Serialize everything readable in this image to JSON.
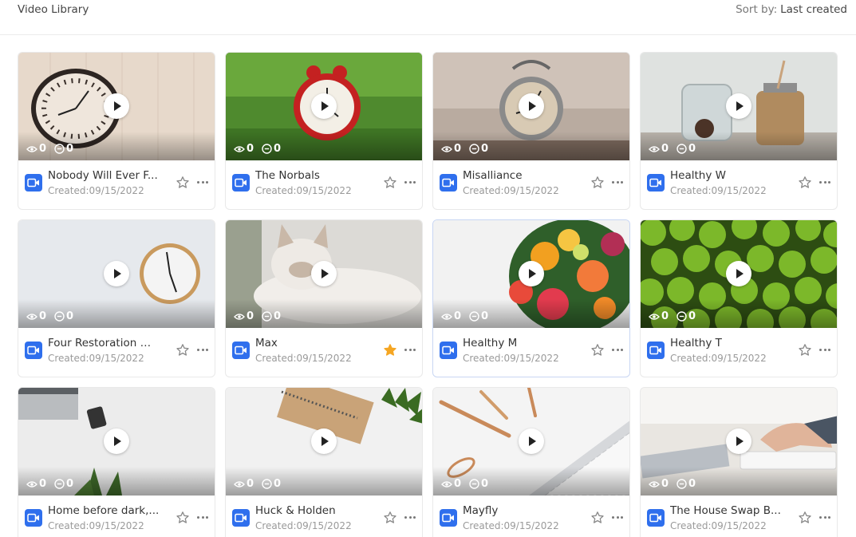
{
  "header": {
    "title": "Video Library",
    "sort_label": "Sort by:",
    "sort_value": "Last created"
  },
  "icons": {
    "views": "eye-icon",
    "comments": "minus-circle-icon",
    "video": "video-camera-icon",
    "favorite": "star-icon",
    "more": "more-horizontal-icon",
    "play": "play-icon"
  },
  "colors": {
    "accent": "#2f6fed",
    "star_active": "#f5a623",
    "star_inactive": "#8a8a8a"
  },
  "videos": [
    {
      "name": "Nobody Will Ever F...",
      "created": "Created:09/15/2022",
      "views": "0",
      "comments": "0",
      "favorite": false,
      "thumbnail": "wall-clock-on-wood"
    },
    {
      "name": "The Norbals",
      "created": "Created:09/15/2022",
      "views": "0",
      "comments": "0",
      "favorite": false,
      "thumbnail": "red-alarm-clock-grass"
    },
    {
      "name": "Misalliance",
      "created": "Created:09/15/2022",
      "views": "0",
      "comments": "0",
      "favorite": false,
      "thumbnail": "silver-alarm-clock"
    },
    {
      "name": "Healthy W",
      "created": "Created:09/15/2022",
      "views": "0",
      "comments": "0",
      "favorite": false,
      "thumbnail": "glass-jars"
    },
    {
      "name": "Four Restoration M...",
      "created": "Created:09/15/2022",
      "views": "0",
      "comments": "0",
      "favorite": false,
      "thumbnail": "wall-clock-white"
    },
    {
      "name": "Max",
      "created": "Created:09/15/2022",
      "views": "0",
      "comments": "0",
      "favorite": true,
      "thumbnail": "white-cat"
    },
    {
      "name": "Healthy M",
      "created": "Created:09/15/2022",
      "views": "0",
      "comments": "0",
      "favorite": false,
      "thumbnail": "fruit-platter"
    },
    {
      "name": "Healthy T",
      "created": "Created:09/15/2022",
      "views": "0",
      "comments": "0",
      "favorite": false,
      "thumbnail": "green-apples"
    },
    {
      "name": "Home before dark,...",
      "created": "Created:09/15/2022",
      "views": "0",
      "comments": "0",
      "favorite": false,
      "thumbnail": "desk-laptop-phone"
    },
    {
      "name": "Huck & Holden",
      "created": "Created:09/15/2022",
      "views": "0",
      "comments": "0",
      "favorite": false,
      "thumbnail": "notebook-plant"
    },
    {
      "name": "Mayfly",
      "created": "Created:09/15/2022",
      "views": "0",
      "comments": "0",
      "favorite": false,
      "thumbnail": "keyboard-pens"
    },
    {
      "name": "The House Swap B...",
      "created": "Created:09/15/2022",
      "views": "0",
      "comments": "0",
      "favorite": false,
      "thumbnail": "typing-hands"
    }
  ]
}
